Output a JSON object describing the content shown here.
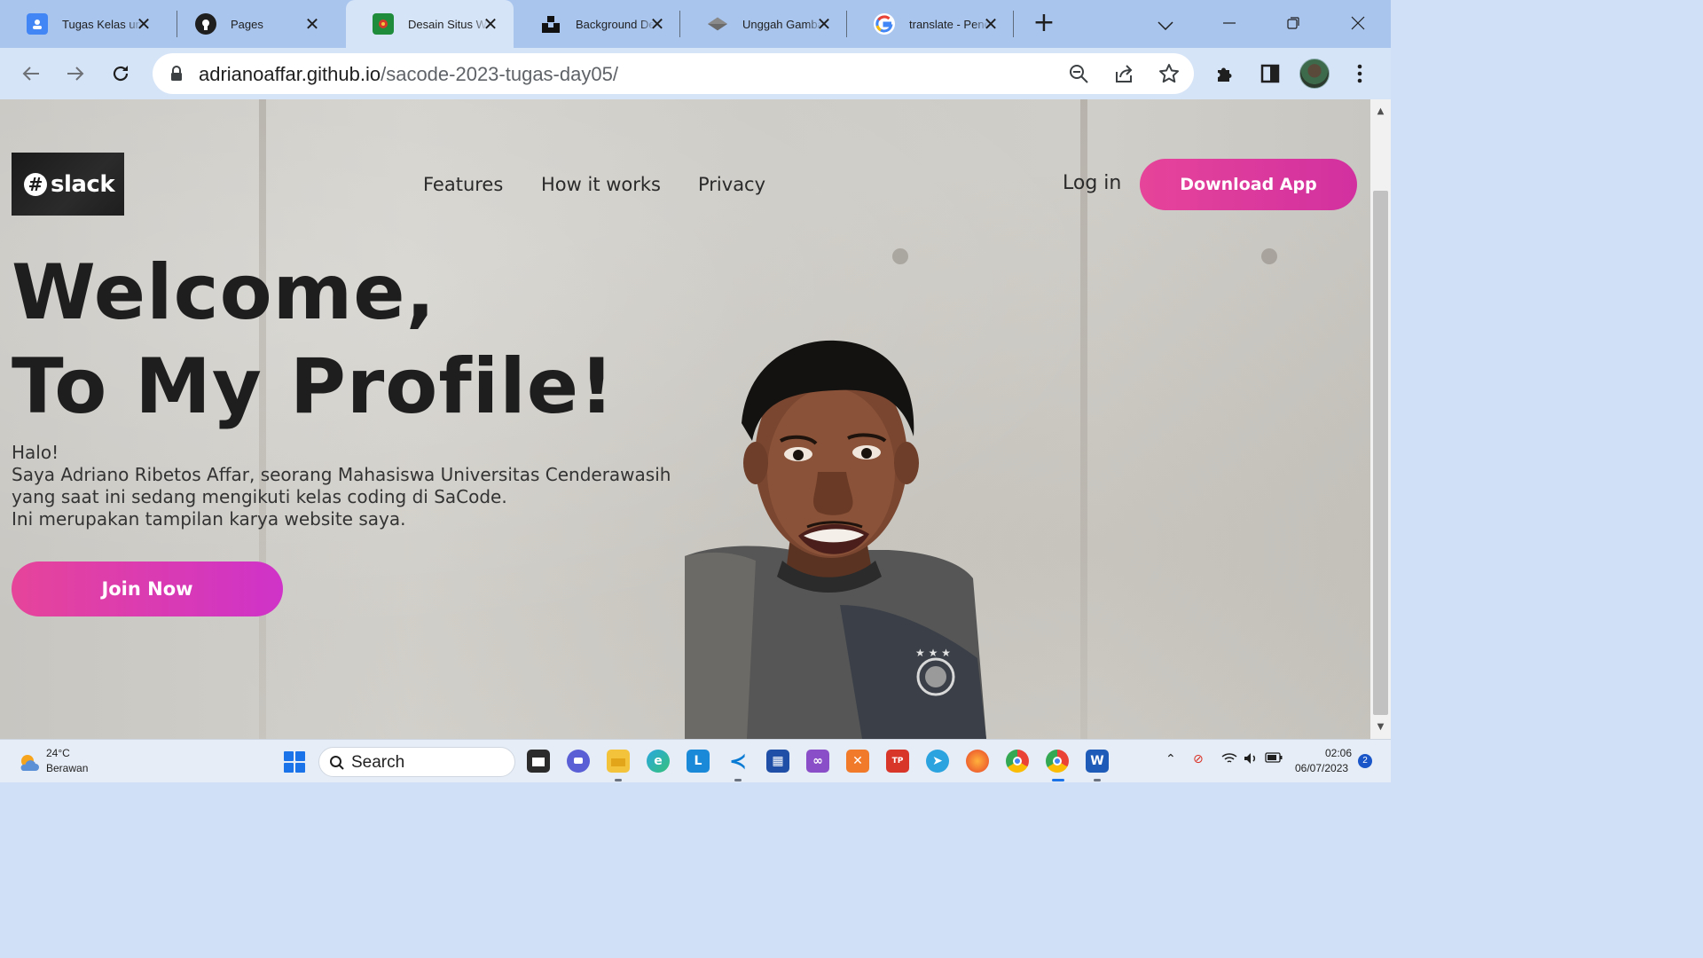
{
  "browser": {
    "tabs": [
      {
        "title": "Tugas Kelas untuk",
        "icon": "classroom-icon",
        "color": "#4285f4"
      },
      {
        "title": "Pages",
        "icon": "github-icon",
        "color": "#1f1f1f"
      },
      {
        "title": "Desain Situs Web",
        "icon": "site-icon",
        "color": "#1e8c3a",
        "active": true
      },
      {
        "title": "Background Design",
        "icon": "unsplash-icon",
        "color": "#111111"
      },
      {
        "title": "Unggah Gambar",
        "icon": "imgbb-icon",
        "color": "#6b6b6b"
      },
      {
        "title": "translate - Penelusuran Google",
        "icon": "google-icon",
        "color": "#4285f4"
      }
    ],
    "url_domain": "adrianoaffar.github.io",
    "url_path": "/sacode-2023-tugas-day05/"
  },
  "page": {
    "logo_text": "slack",
    "nav": [
      "Features",
      "How it works",
      "Privacy"
    ],
    "login": "Log in",
    "download_button": "Download App",
    "hero_line1": "Welcome,",
    "hero_line2": "To My Profile!",
    "intro": [
      "Halo!",
      "Saya Adriano Ribetos Affar, seorang Mahasiswa Universitas Cenderawasih",
      "yang saat ini sedang mengikuti kelas coding di SaCode.",
      "Ini merupakan tampilan karya website saya."
    ],
    "join_button": "Join Now",
    "accent_color": "#e2439b"
  },
  "taskbar": {
    "weather_temp": "24°C",
    "weather_desc": "Berawan",
    "search_placeholder": "Search",
    "time": "02:06",
    "date": "06/07/2023",
    "notification_count": "2"
  }
}
